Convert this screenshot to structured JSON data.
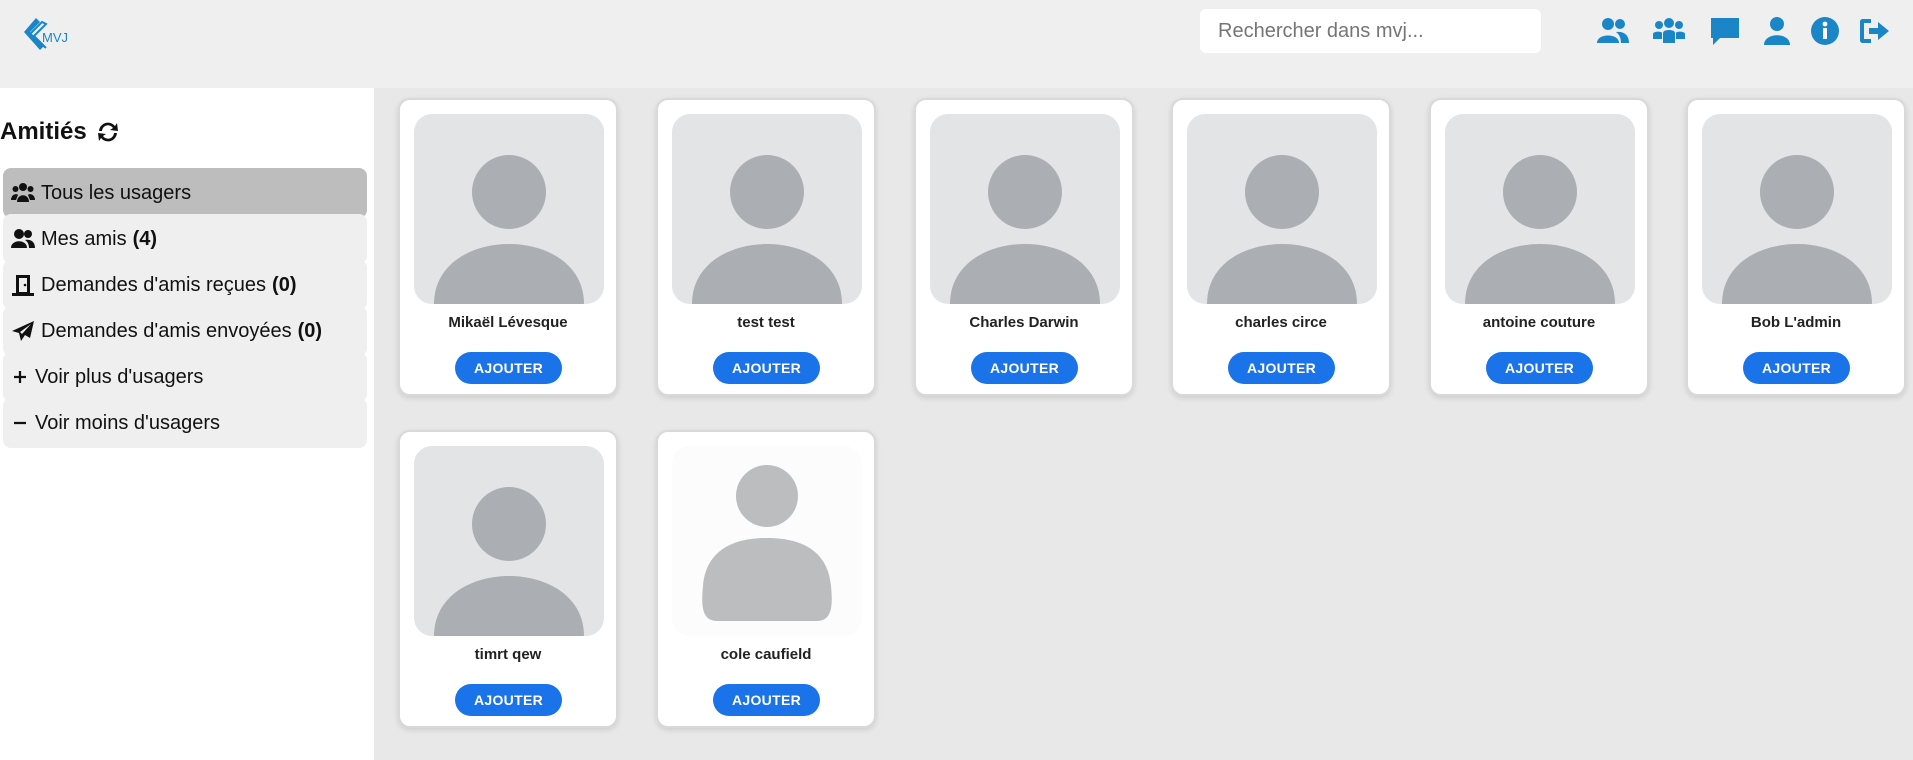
{
  "header": {
    "logo_text": "MVJ",
    "search_placeholder": "Rechercher dans mvj..."
  },
  "nav_icons": [
    "users-icon",
    "groups-icon",
    "chat-icon",
    "profile-icon",
    "info-icon",
    "logout-icon"
  ],
  "sidebar": {
    "title": "Amitiés",
    "items": [
      {
        "label": "Tous les usagers",
        "count": "",
        "icon": "users-icon",
        "active": true
      },
      {
        "label": "Mes amis",
        "count": "(4)",
        "icon": "friends-icon",
        "active": false
      },
      {
        "label": "Demandes d'amis reçues",
        "count": "(0)",
        "icon": "door-icon",
        "active": false
      },
      {
        "label": "Demandes d'amis envoyées",
        "count": "(0)",
        "icon": "paper-plane-icon",
        "active": false
      },
      {
        "label": "Voir plus d'usagers",
        "count": "",
        "icon": "plus-icon",
        "active": false
      },
      {
        "label": "Voir moins d'usagers",
        "count": "",
        "icon": "minus-icon",
        "active": false
      }
    ]
  },
  "users": [
    {
      "name": "Mikaël Lévesque",
      "button": "AJOUTER"
    },
    {
      "name": "test test",
      "button": "AJOUTER"
    },
    {
      "name": "Charles Darwin",
      "button": "AJOUTER"
    },
    {
      "name": "charles circe",
      "button": "AJOUTER"
    },
    {
      "name": "antoine couture",
      "button": "AJOUTER"
    },
    {
      "name": "Bob L'admin",
      "button": "AJOUTER"
    },
    {
      "name": "timrt qew",
      "button": "AJOUTER"
    },
    {
      "name": "cole caufield",
      "button": "AJOUTER"
    }
  ],
  "colors": {
    "accent": "#1a86c8",
    "button": "#1a73e8",
    "header_bg": "#efefef",
    "main_bg": "#e8e8e8",
    "active_item": "#bdbdbd"
  }
}
